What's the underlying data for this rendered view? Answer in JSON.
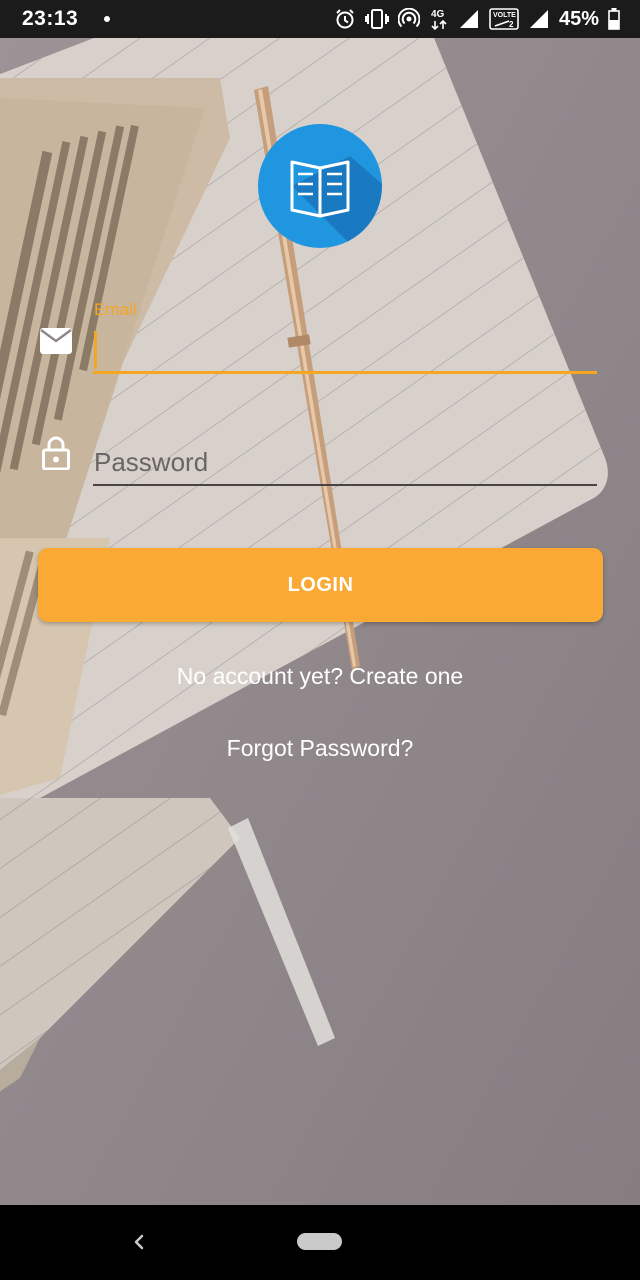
{
  "status_bar": {
    "time": "23:13",
    "battery_percent": "45%",
    "icons": [
      "notification-dot",
      "alarm-icon",
      "vibrate-icon",
      "hotspot-icon",
      "4g-icon",
      "signal-icon",
      "volte-icon",
      "signal-icon",
      "battery-icon"
    ],
    "volte_label": "VOLTE",
    "volte_sub": "2",
    "network_label": "4G"
  },
  "logo": {
    "icon": "open-book-icon",
    "color": "#2196e0"
  },
  "form": {
    "email_label": "Email",
    "email_value": "",
    "email_icon": "mail-icon",
    "password_placeholder": "Password",
    "password_value": "",
    "password_icon": "lock-icon",
    "accent_color": "#f5a623"
  },
  "actions": {
    "login_label": "LOGIN",
    "create_account_label": "No account yet? Create one",
    "forgot_password_label": "Forgot Password?",
    "button_color": "#f9a934"
  },
  "nav_bar": {
    "back_icon": "back-chevron-icon",
    "home_icon": "home-pill-icon"
  }
}
